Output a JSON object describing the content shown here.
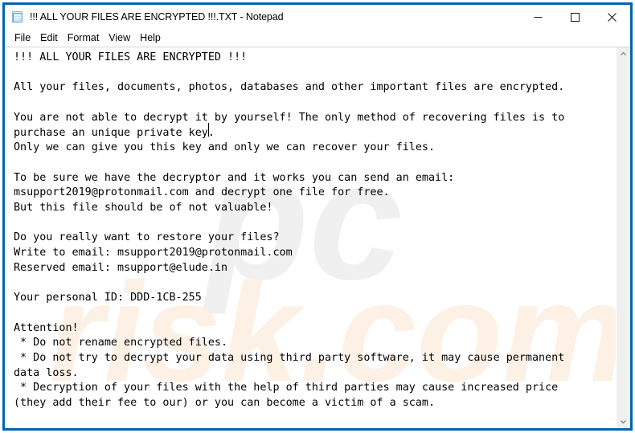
{
  "window": {
    "title": "!!! ALL YOUR FILES ARE ENCRYPTED !!!.TXT - Notepad",
    "app_icon": "notepad-icon",
    "border_color": "#0063b1",
    "background": "#ffffff"
  },
  "window_controls": {
    "minimize_label": "Minimize",
    "maximize_label": "Maximize",
    "close_label": "Close"
  },
  "menu": {
    "items": [
      {
        "label": "File"
      },
      {
        "label": "Edit"
      },
      {
        "label": "Format"
      },
      {
        "label": "View"
      },
      {
        "label": "Help"
      }
    ]
  },
  "document": {
    "content": "!!! ALL YOUR FILES ARE ENCRYPTED !!!\n\nAll your files, documents, photos, databases and other important files are encrypted.\n\nYou are not able to decrypt it by yourself! The only method of recovering files is to\npurchase an unique private key.\nOnly we can give you this key and only we can recover your files.\n\nTo be sure we have the decryptor and it works you can send an email:\nmsupport2019@protonmail.com and decrypt one file for free.\nBut this file should be of not valuable!\n\nDo you really want to restore your files?\nWrite to email: msupport2019@protonmail.com\nReserved email: msupport@elude.in\n\nYour personal ID: DDD-1CB-255\n\nAttention!\n * Do not rename encrypted files.\n * Do not try to decrypt your data using third party software, it may cause permanent\ndata loss.\n * Decryption of your files with the help of third parties may cause increased price\n(they add their fee to our) or you can become a victim of a scam.",
    "personal_id": "DDD-1CB-255",
    "contact_email_primary": "msupport2019@protonmail.com",
    "contact_email_reserved": "msupport@elude.in",
    "text_color": "#000000",
    "caret_visible": true
  },
  "watermark": {
    "grey_text": "pc",
    "orange_text": "risk.com",
    "grey_color": "#f0f0f0",
    "orange_color": "#fdf0e4"
  },
  "scrollbar": {
    "up_arrow": "chevron-up-icon",
    "down_arrow": "chevron-down-icon",
    "thumb_visible": false
  }
}
